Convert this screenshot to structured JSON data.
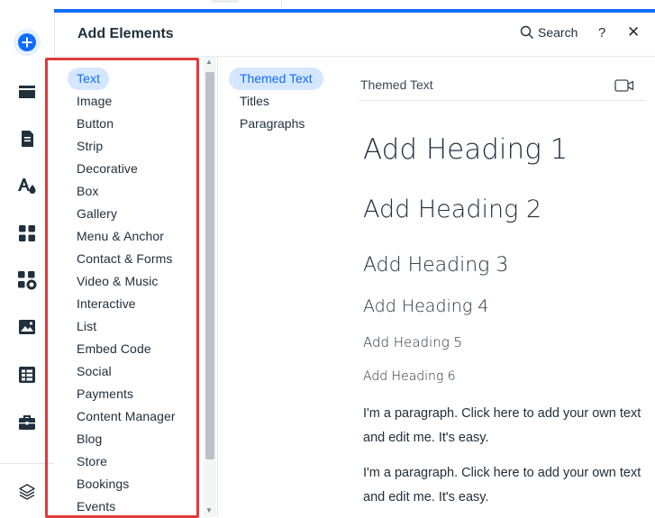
{
  "panel": {
    "title": "Add Elements",
    "search_label": "Search",
    "help_label": "?",
    "close_label": "✕"
  },
  "toolbar": {
    "items": [
      "add-icon",
      "sections-icon",
      "pages-icon",
      "site-design-icon",
      "apps-icon",
      "business-solutions-icon",
      "media-icon",
      "cms-icon",
      "portfolio-icon",
      "layers-icon"
    ]
  },
  "categories": [
    {
      "label": "Text",
      "active": true
    },
    {
      "label": "Image"
    },
    {
      "label": "Button"
    },
    {
      "label": "Strip"
    },
    {
      "label": "Decorative"
    },
    {
      "label": "Box"
    },
    {
      "label": "Gallery"
    },
    {
      "label": "Menu & Anchor"
    },
    {
      "label": "Contact & Forms"
    },
    {
      "label": "Video & Music"
    },
    {
      "label": "Interactive"
    },
    {
      "label": "List"
    },
    {
      "label": "Embed Code"
    },
    {
      "label": "Social"
    },
    {
      "label": "Payments"
    },
    {
      "label": "Content Manager"
    },
    {
      "label": "Blog"
    },
    {
      "label": "Store"
    },
    {
      "label": "Bookings"
    },
    {
      "label": "Events"
    }
  ],
  "subcategories": [
    {
      "label": "Themed Text",
      "active": true
    },
    {
      "label": "Titles"
    },
    {
      "label": "Paragraphs"
    }
  ],
  "content": {
    "section_title": "Themed Text",
    "headings": [
      "Add Heading 1",
      "Add Heading 2",
      "Add Heading 3",
      "Add Heading 4",
      "Add Heading 5",
      "Add Heading 6"
    ],
    "paragraphs": [
      "I'm a paragraph. Click here to add your own text and edit me. It's easy.",
      "I'm a paragraph. Click here to add your own text and edit me. It's easy."
    ]
  },
  "colors": {
    "accent": "#116dff",
    "active_bg": "#d5e7ff",
    "highlight": "#e3393c"
  }
}
